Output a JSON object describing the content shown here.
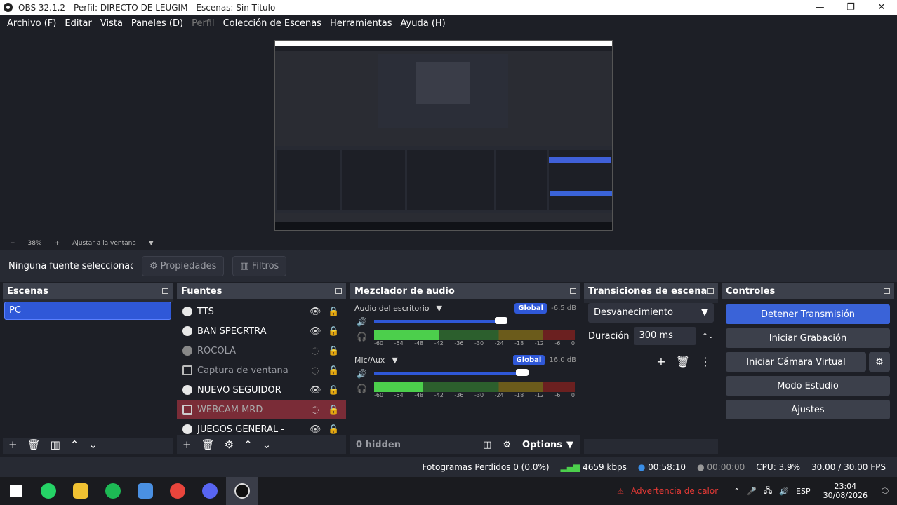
{
  "window": {
    "title": "OBS 32.1.2 - Perfil: DIRECTO DE LEUGIM - Escenas: Sin Título"
  },
  "menu": [
    "Archivo (F)",
    "Editar",
    "Vista",
    "Paneles (D)",
    "Perfil",
    "Colección de Escenas",
    "Herramientas",
    "Ayuda (H)"
  ],
  "zoom": {
    "minus": "−",
    "value": "38%",
    "plus": "+",
    "fit_label": "Ajustar a la ventana"
  },
  "source_bar": {
    "none_selected": "Ninguna fuente seleccionac",
    "properties": "Propiedades",
    "filters": "Filtros"
  },
  "scenes": {
    "title": "Escenas",
    "items": [
      "PC"
    ]
  },
  "sources": {
    "title": "Fuentes",
    "items": [
      "TTS",
      "BAN SPECRTRA",
      "ROCOLA",
      "Captura de ventana",
      "NUEVO SEGUIDOR",
      "WEBCAM MRD",
      "JUEGOS GENERAL -"
    ]
  },
  "mixer": {
    "title": "Mezclador de audio",
    "ch1": {
      "name": "Audio del escritorio",
      "badge": "Global",
      "db": "-6.5 dB",
      "volume": 0.86,
      "level": 0.32
    },
    "ch2": {
      "name": "Mic/Aux",
      "badge": "Global",
      "db": "16.0 dB",
      "volume": 1.0,
      "level": 0.24
    },
    "ticks": [
      "-60",
      "-54",
      "-48",
      "-42",
      "-36",
      "-30",
      "-24",
      "-18",
      "-12",
      "-6",
      "0"
    ],
    "hidden": "0 hidden",
    "options": "Options"
  },
  "transitions": {
    "title": "Transiciones de escena",
    "selected": "Desvanecimiento",
    "duration_label": "Duración",
    "duration_value": "300 ms"
  },
  "controls": {
    "title": "Controles",
    "stop_stream": "Detener Transmisión",
    "start_record": "Iniciar Grabación",
    "virtual_cam": "Iniciar Cámara Virtual",
    "studio_mode": "Modo Estudio",
    "settings": "Ajustes"
  },
  "status": {
    "dropped": "Fotogramas Perdidos 0 (0.0%)",
    "bitrate": "4659 kbps",
    "stream_time": "00:58:10",
    "rec_time": "00:00:00",
    "cpu": "CPU: 3.9%",
    "fps": "30.00 / 30.00 FPS"
  },
  "taskbar": {
    "warning": "Advertencia de calor",
    "lang": "ESP",
    "time": "23:04",
    "date": "30/08/2026"
  },
  "colors": {
    "accent": "#2f58d8",
    "selected_source": "#7a2c37",
    "background": "#1d1f26"
  }
}
